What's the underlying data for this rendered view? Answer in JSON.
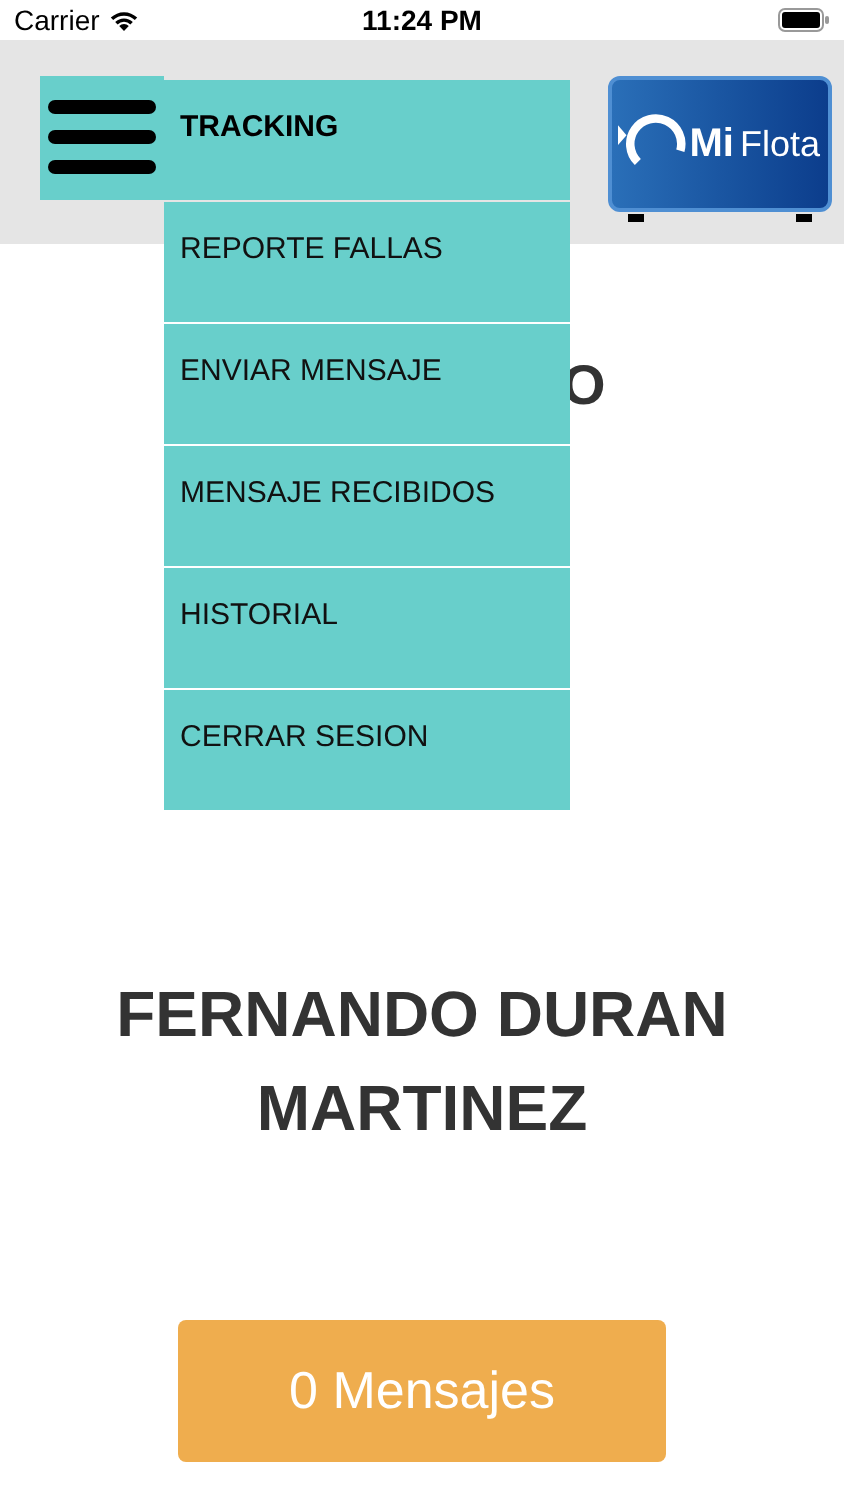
{
  "status_bar": {
    "carrier": "Carrier",
    "time": "11:24 PM"
  },
  "logo": {
    "text_1": "Mi",
    "text_2": "Flota"
  },
  "menu": {
    "items": [
      {
        "label": "TRACKING",
        "selected": true
      },
      {
        "label": "REPORTE FALLAS",
        "selected": false
      },
      {
        "label": "ENVIAR MENSAJE",
        "selected": false
      },
      {
        "label": "MENSAJE RECIBIDOS",
        "selected": false
      },
      {
        "label": "HISTORIAL",
        "selected": false
      },
      {
        "label": "CERRAR SESION",
        "selected": false
      }
    ]
  },
  "hidden_heading": "O",
  "user_name": "FERNANDO DURAN MARTINEZ",
  "messages_button": "0 Mensajes"
}
